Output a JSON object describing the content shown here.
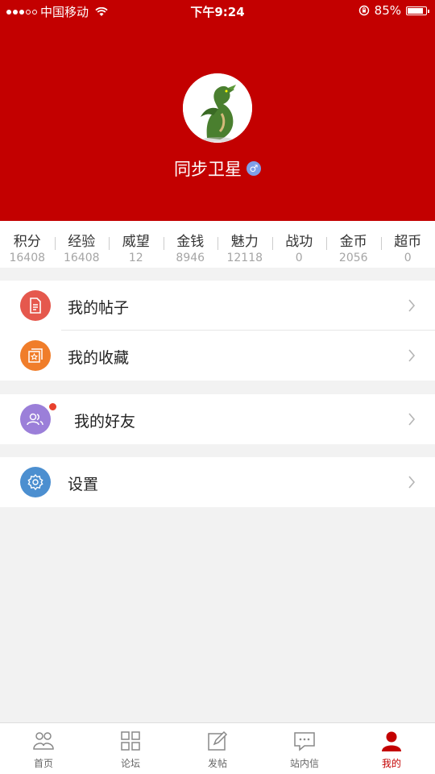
{
  "status_bar": {
    "carrier": "中国移动",
    "time": "下午9:24",
    "battery": "85%",
    "battery_level": 0.85
  },
  "profile": {
    "username": "同步卫星",
    "gender_symbol": "♂",
    "avatar_icon": "dragon-avatar"
  },
  "stats": [
    {
      "label": "积分",
      "value": "16408"
    },
    {
      "label": "经验",
      "value": "16408"
    },
    {
      "label": "威望",
      "value": "12"
    },
    {
      "label": "金钱",
      "value": "8946"
    },
    {
      "label": "魅力",
      "value": "12118"
    },
    {
      "label": "战功",
      "value": "0"
    },
    {
      "label": "金币",
      "value": "2056"
    },
    {
      "label": "超币",
      "value": "0"
    }
  ],
  "menu": {
    "my_posts": {
      "label": "我的帖子",
      "icon": "document-icon",
      "color": "#e5584d"
    },
    "my_favorites": {
      "label": "我的收藏",
      "icon": "star-folder-icon",
      "color": "#f07d2a"
    },
    "my_friends": {
      "label": "我的好友",
      "icon": "people-icon",
      "color": "#9b7fd9",
      "has_badge": true
    },
    "settings": {
      "label": "设置",
      "icon": "gear-icon",
      "color": "#4c8fd0"
    }
  },
  "tabs": [
    {
      "label": "首页",
      "icon": "home-people-icon",
      "active": false
    },
    {
      "label": "论坛",
      "icon": "grid-icon",
      "active": false
    },
    {
      "label": "发帖",
      "icon": "compose-icon",
      "active": false
    },
    {
      "label": "站内信",
      "icon": "message-icon",
      "active": false
    },
    {
      "label": "我的",
      "icon": "person-icon",
      "active": true
    }
  ],
  "colors": {
    "brand_red": "#c30000",
    "background": "#f2f2f2"
  }
}
